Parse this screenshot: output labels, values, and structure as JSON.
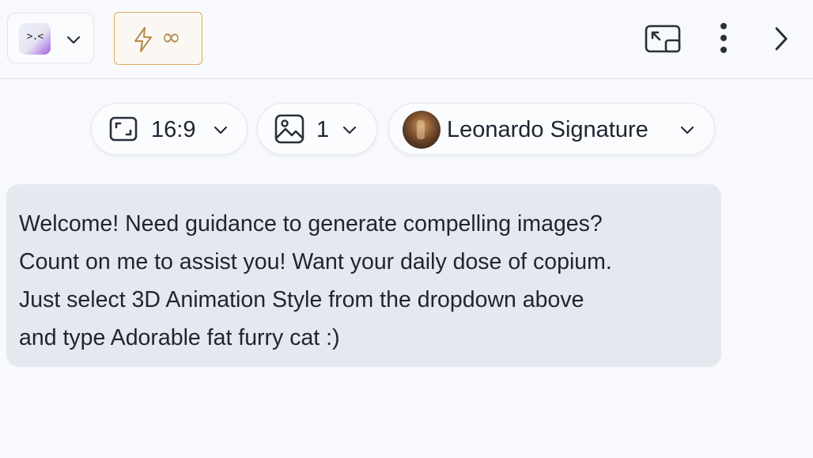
{
  "header": {
    "app_logo_face": ">.<",
    "token_count": "∞"
  },
  "settings": {
    "aspect_ratio": "16:9",
    "image_count": "1",
    "model": "Leonardo Signature"
  },
  "chat": {
    "welcome_message": "Welcome! Need guidance to generate compelling images?\nCount on me to assist you! Want your daily dose of copium.\nJust select 3D Animation Style from the dropdown above\nand type Adorable fat furry cat :)"
  },
  "colors": {
    "accent_token_border": "#e2ac5a",
    "bubble_bg": "#e5e8ef",
    "page_bg": "#f7f9fc"
  },
  "icons": [
    "app-logo",
    "chevron-down-icon",
    "lightning-icon",
    "picture-in-picture-icon",
    "more-vertical-icon",
    "chevron-right-icon",
    "aspect-ratio-icon",
    "image-icon"
  ]
}
